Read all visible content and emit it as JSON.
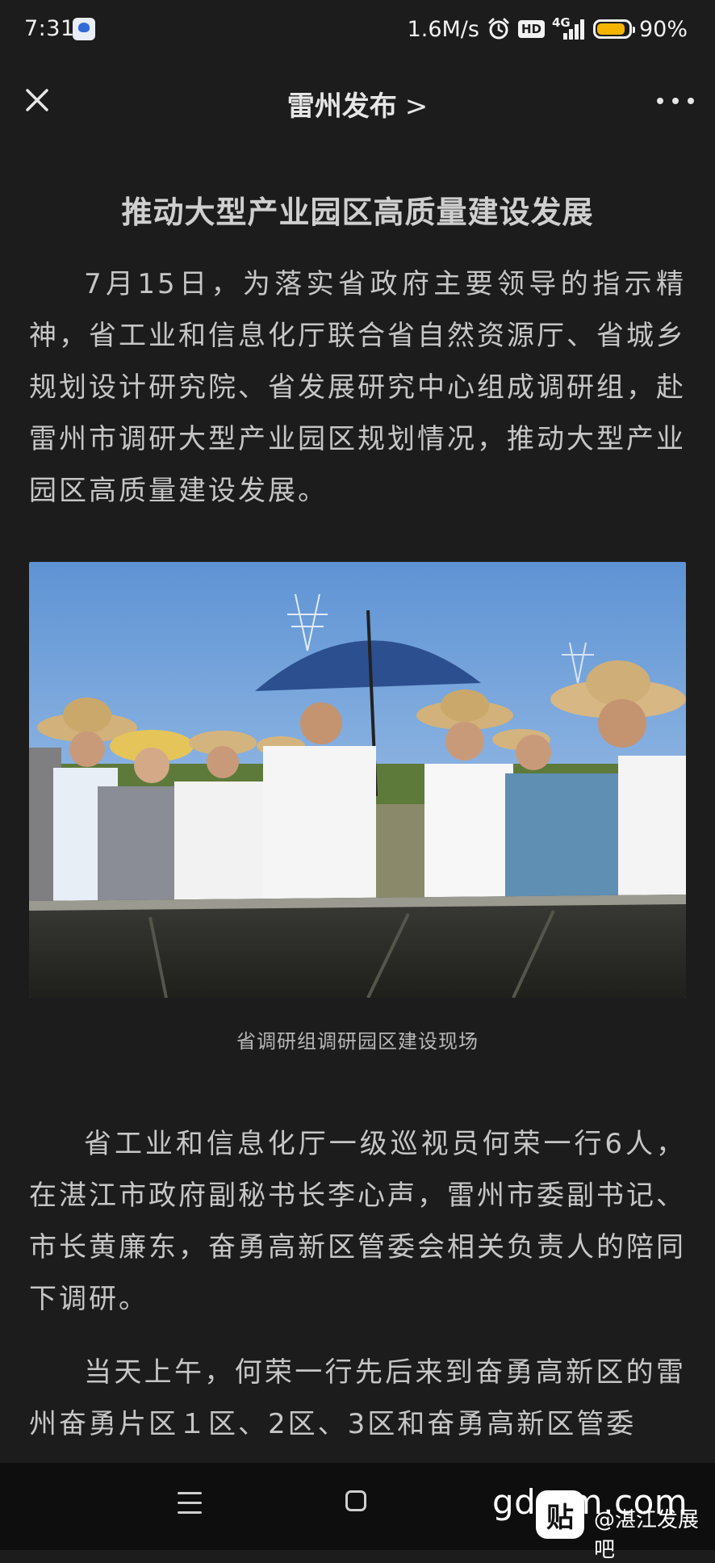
{
  "status_bar": {
    "time": "7:31",
    "net_speed": "1.6M/s",
    "hd": "HD",
    "net_type": "4G",
    "battery": "90%",
    "battery_level": 0.9
  },
  "nav": {
    "title": "雷州发布",
    "chevron": ">"
  },
  "article": {
    "title": "推动大型产业园区高质量建设发展",
    "paragraph_1": "7月15日，为落实省政府主要领导的指示精神，省工业和信息化厅联合省自然资源厅、省城乡规划设计研究院、省发展研究中心组成调研组，赴雷州市调研大型产业园区规划情况，推动大型产业园区高质量建设发展。",
    "photo_caption": "省调研组调研园区建设现场",
    "paragraph_2": "省工业和信息化厅一级巡视员何荣一行6人，在湛江市政府副秘书长李心声，雷州市委副书记、市长黄廉东，奋勇高新区管委会相关负责人的陪同下调研。",
    "paragraph_3": "当天上午，何荣一行先后来到奋勇高新区的雷州奋勇片区１区、2区、3区和奋勇高新区管委"
  },
  "watermark": {
    "site": "gdmm.com",
    "logo_char": "贴",
    "text": "@湛江发展吧"
  },
  "colors": {
    "background": "#1c1c1c",
    "text": "#c6c6c6",
    "battery": "#f4b400"
  }
}
